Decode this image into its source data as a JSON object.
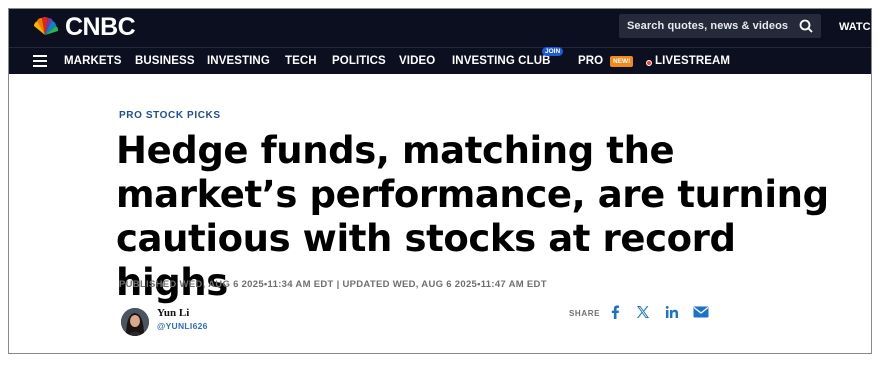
{
  "brand": {
    "name": "CNBC"
  },
  "header": {
    "search_placeholder": "Search quotes, news & videos",
    "watch_label": "WATC"
  },
  "nav": {
    "items": [
      "MARKETS",
      "BUSINESS",
      "INVESTING",
      "TECH",
      "POLITICS",
      "VIDEO",
      "INVESTING CLUB",
      "PRO",
      "LIVESTREAM"
    ],
    "join_badge": "JOIN",
    "new_badge": "NEW!"
  },
  "article": {
    "kicker": "PRO STOCK PICKS",
    "headline": "Hedge funds, matching the market’s performance, are turning cautious with stocks at record highs",
    "published": "PUBLISHED WED, AUG 6 2025•11:34 AM EDT | UPDATED WED, AUG 6 2025•11:47 AM EDT",
    "author": {
      "name": "Yun Li",
      "handle": "@YUNLI626"
    }
  },
  "share": {
    "label": "SHARE"
  },
  "colors": {
    "nav_bg": "#0b0f1f",
    "kicker": "#1d4f91",
    "share_blue": "#1a73c9",
    "new_badge": "#f28a1b",
    "join_badge": "#1e5bd6"
  }
}
